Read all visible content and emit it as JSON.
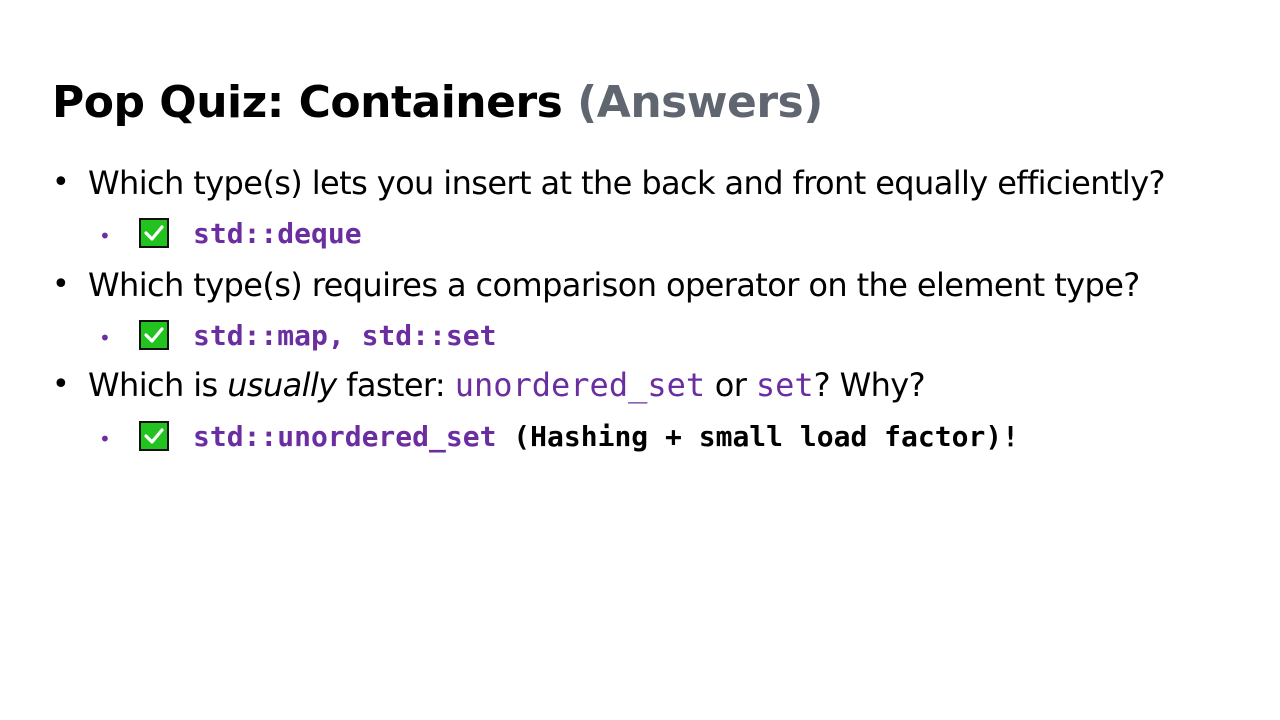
{
  "slide": {
    "title_main": "Pop Quiz: Containers",
    "title_sub": "(Answers)",
    "questions": [
      {
        "text": "Which type(s) lets you insert at the back and front equally efficiently?",
        "answer": "std::deque",
        "answer_tail": ""
      },
      {
        "text": "Which type(s) requires a comparison operator on the element type?",
        "answer": "std::map, std::set",
        "answer_tail": ""
      },
      {
        "text_prefix": "Which is ",
        "text_emph": "usually",
        "text_mid": " faster: ",
        "code_a": "unordered_set",
        "text_or": " or ",
        "code_b": "set",
        "text_end": "? Why?",
        "answer": "std::unordered_set",
        "answer_tail": " (Hashing + small load factor)!"
      }
    ]
  },
  "colors": {
    "code_purple": "#6a2ea0",
    "subtitle_gray": "#5f6670",
    "check_green": "#22c31e"
  },
  "icons": {
    "answer_marker": "check-mark-box-icon"
  }
}
